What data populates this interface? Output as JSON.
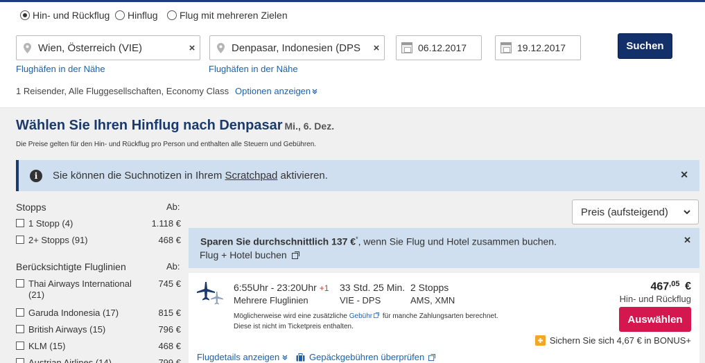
{
  "trip_type": {
    "options": [
      {
        "label": "Hin- und Rückflug",
        "selected": true
      },
      {
        "label": "Hinflug",
        "selected": false
      },
      {
        "label": "Flug mit mehreren Zielen",
        "selected": false
      }
    ]
  },
  "search": {
    "origin": "Wien, Österreich (VIE)",
    "destination": "Denpasar, Indonesien (DPS",
    "depart_date": "06.12.2017",
    "return_date": "19.12.2017",
    "nearby_airports_label": "Flughäfen in der Nähe",
    "clear_icon": "×",
    "search_button": "Suchen",
    "summary": "1 Reisender, Alle Fluggesellschaften, Economy Class",
    "options_link": "Optionen anzeigen"
  },
  "results_header": {
    "title": "Wählen Sie Ihren Hinflug nach Denpasar",
    "date": "Mi., 6. Dez.",
    "disclaimer": "Die Preise gelten für den Hin- und Rückflug pro Person und enthalten alle Steuern und Gebühren."
  },
  "notice": {
    "text_before": "Sie können die Suchnotizen in Ihrem ",
    "link": "Scratchpad",
    "text_after": " aktivieren."
  },
  "filters": {
    "ab_label": "Ab:",
    "stops": {
      "heading": "Stopps",
      "items": [
        {
          "label": "1 Stopp (4)",
          "price": "1.118 €"
        },
        {
          "label": "2+ Stopps (91)",
          "price": "468 €"
        }
      ]
    },
    "airlines": {
      "heading": "Berücksichtigte Fluglinien",
      "items": [
        {
          "label": "Thai Airways International (21)",
          "price": "745 €"
        },
        {
          "label": "Garuda Indonesia (17)",
          "price": "815 €"
        },
        {
          "label": "British Airways (15)",
          "price": "796 €"
        },
        {
          "label": "KLM (15)",
          "price": "468 €"
        },
        {
          "label": "Austrian Airlines (14)",
          "price": "799 €"
        }
      ]
    }
  },
  "sort": {
    "selected": "Preis (aufsteigend)"
  },
  "promo": {
    "bold": "Sparen Sie durchschnittlich 137 €",
    "asterisk": "*",
    "rest": ", wenn Sie Flug und Hotel zusammen buchen.",
    "link": "Flug + Hotel buchen"
  },
  "flight": {
    "times": "6:55Uhr - 23:20Uhr",
    "day_offset": "+1",
    "airlines": "Mehrere Fluglinien",
    "duration": "33 Std. 25 Min.",
    "route": "VIE - DPS",
    "stops": "2 Stopps",
    "stop_airports": "AMS, XMN",
    "fee_note_before": "Möglicherweise wird eine zusätzliche ",
    "fee_link": "Gebühr",
    "fee_note_after": " für manche Zahlungsarten berechnet.",
    "fee_note_line2": "Diese ist nicht im Ticketpreis enthalten.",
    "price_main": "467",
    "price_cents": ",05",
    "price_currency": "€",
    "price_note": "Hin- und Rückflug",
    "select_button": "Auswählen",
    "bonus": "Sichern Sie sich 4,67 € in BONUS+",
    "details_link": "Flugdetails anzeigen",
    "baggage_link": "Gepäckgebühren überprüfen"
  },
  "colors": {
    "brand_navy": "#13306a",
    "link_blue": "#1a62b0",
    "select_red": "#d4174f",
    "notice_bg": "#cfdff0"
  }
}
